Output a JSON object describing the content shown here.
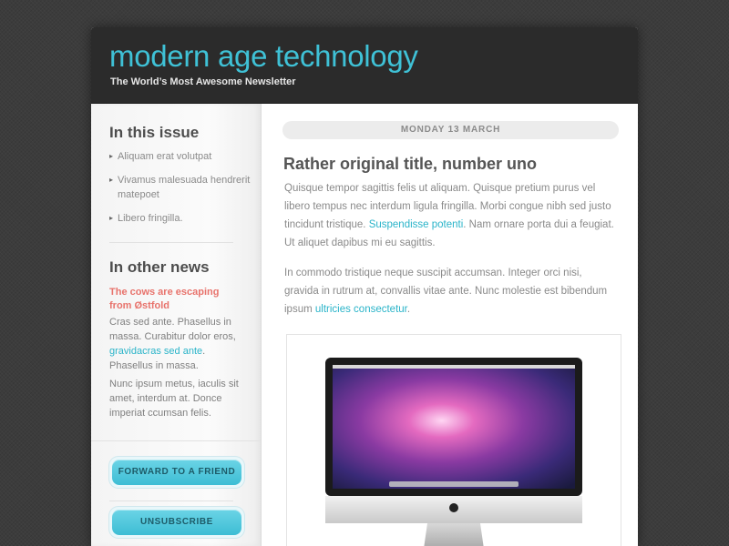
{
  "header": {
    "brand": "modern age technology",
    "tagline": "The World’s Most Awesome Newsletter"
  },
  "sidebar": {
    "in_this_issue": {
      "heading": "In this issue",
      "items": [
        {
          "label": "Aliquam erat volutpat"
        },
        {
          "label": "Vivamus malesuada hendrerit matepoet"
        },
        {
          "label": "Libero fringilla."
        }
      ]
    },
    "other_news": {
      "heading": "In other news",
      "headline": "The cows are escaping from Østfold",
      "p1_before": "Cras sed ante. Phasellus in massa. Curabitur dolor eros, ",
      "p1_link": "gravidacras sed ante",
      "p1_after": ". Phasellus in massa.",
      "p2": "Nunc ipsum metus, iaculis sit amet, interdum at. Donce imperiat ccumsan felis."
    },
    "buttons": {
      "forward": "FORWARD TO A FRIEND",
      "unsubscribe": "UNSUBSCRIBE"
    }
  },
  "main": {
    "date": "MONDAY 13 MARCH",
    "title": "Rather original title, number uno",
    "p1_before": "Quisque tempor sagittis felis ut aliquam. Quisque pretium purus vel libero tempus nec interdum ligula fringilla. Morbi congue nibh sed justo tincidunt tristique. ",
    "p1_link": "Suspendisse potenti",
    "p1_after": ". Nam ornare porta dui a feugiat. Ut aliquet dapibus mi eu sagittis.",
    "p2_before": "In commodo tristique neque suscipit accumsan. Integer orci nisi, gravida in rutrum at, convallis vitae ante. Nunc molestie est bibendum ipsum ",
    "p2_link": "ultricies consectetur",
    "p2_after": "."
  },
  "colors": {
    "brand": "#3fc1d6",
    "link": "#2ab4c9",
    "headline_red": "#e8736c",
    "header_bg": "#2b2b2b"
  },
  "image": {
    "icon": "imac-computer-icon"
  }
}
